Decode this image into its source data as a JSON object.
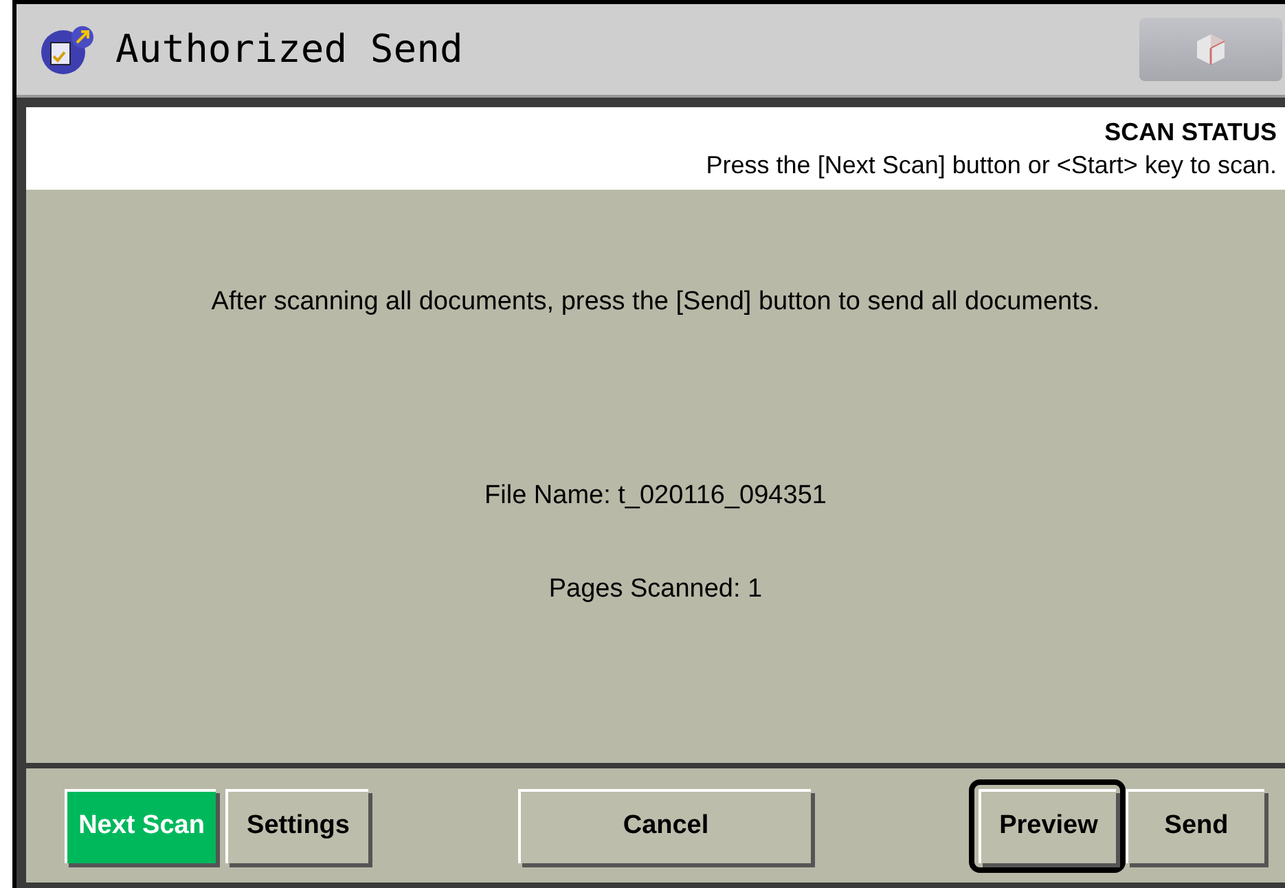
{
  "window": {
    "title": "Authorized Send"
  },
  "header_button": {
    "disabled": true
  },
  "header": {
    "title": "SCAN STATUS",
    "instruction": "Press the [Next Scan] button or <Start> key to scan."
  },
  "message": "After scanning all documents, press the [Send] button to send all documents.",
  "file_name": "File Name: t_020116_094351",
  "pages_scanned": "Pages Scanned: 1",
  "buttons": [
    {
      "label": "Next Scan",
      "active": true,
      "focused": false
    },
    {
      "label": "Settings",
      "active": false,
      "focused": false
    },
    {
      "label": "Cancel",
      "active": false,
      "focused": false
    },
    {
      "label": "Preview",
      "active": false,
      "focused": true
    },
    {
      "label": "Send",
      "active": false,
      "focused": false
    }
  ]
}
